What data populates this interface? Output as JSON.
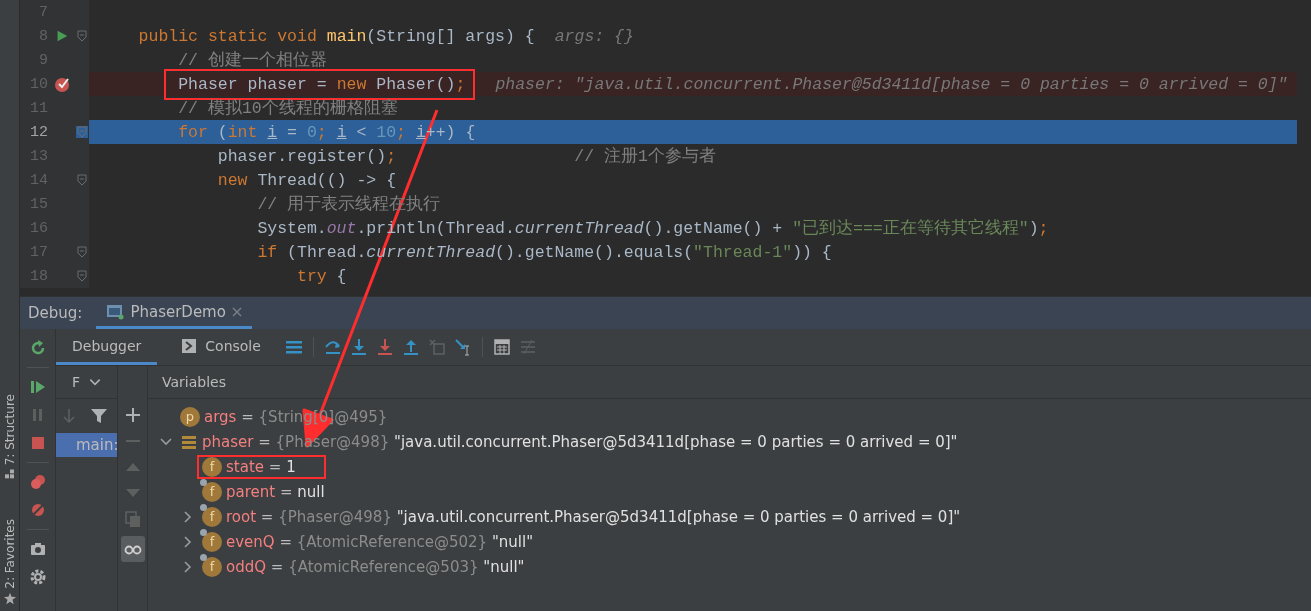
{
  "editor": {
    "lines": [
      {
        "number": "7",
        "kind": "plain",
        "run": false,
        "fold": false,
        "annotated": false
      },
      {
        "number": "8",
        "kind": "plain",
        "run": true,
        "fold": true,
        "annotated": false,
        "tokens": [
          {
            "kind": "keyword",
            "text": "    public static void "
          },
          {
            "kind": "method",
            "text": "main"
          },
          {
            "kind": "plain",
            "text": "(String[] args) {"
          }
        ],
        "hint": "args: {}"
      },
      {
        "number": "9",
        "kind": "plain",
        "run": false,
        "fold": false,
        "annotated": false,
        "tokens": [
          {
            "kind": "comment",
            "text": "        // 创建一个相位器"
          }
        ]
      },
      {
        "number": "10",
        "kind": "breakpoint",
        "run": false,
        "fold": false,
        "annotated": true,
        "tokens": [
          {
            "kind": "plain",
            "text": "        Phaser phaser = "
          },
          {
            "kind": "keyword",
            "text": "new"
          },
          {
            "kind": "plain",
            "text": " Phaser()"
          },
          {
            "kind": "keyword",
            "text": ";"
          }
        ],
        "hint": "phaser: \"java.util.concurrent.Phaser@5d3411d[phase = 0 parties = 0 arrived = 0]\""
      },
      {
        "number": "11",
        "kind": "plain",
        "run": false,
        "fold": false,
        "annotated": false,
        "tokens": [
          {
            "kind": "comment",
            "text": "        // 模拟10个线程的栅格阻塞"
          }
        ]
      },
      {
        "number": "12",
        "kind": "execution",
        "run": false,
        "fold": true,
        "annotated": false,
        "tokens": [
          {
            "kind": "keyword",
            "text": "        for "
          },
          {
            "kind": "plain",
            "text": "("
          },
          {
            "kind": "keyword",
            "text": "int "
          },
          {
            "kind": "variable",
            "text": "i"
          },
          {
            "kind": "plain",
            "text": " = "
          },
          {
            "kind": "number",
            "text": "0"
          },
          {
            "kind": "keyword",
            "text": "; "
          },
          {
            "kind": "variable",
            "text": "i"
          },
          {
            "kind": "plain",
            "text": " < "
          },
          {
            "kind": "number",
            "text": "10"
          },
          {
            "kind": "keyword",
            "text": "; "
          },
          {
            "kind": "variable",
            "text": "i"
          },
          {
            "kind": "plain",
            "text": "++) {"
          }
        ]
      },
      {
        "number": "13",
        "kind": "plain",
        "run": false,
        "fold": false,
        "annotated": false,
        "tokens": [
          {
            "kind": "plain",
            "text": "            phaser.register()"
          },
          {
            "kind": "keyword",
            "text": ";"
          },
          {
            "kind": "comment",
            "text": "                  // 注册1个参与者"
          }
        ]
      },
      {
        "number": "14",
        "kind": "plain",
        "run": false,
        "fold": true,
        "annotated": false,
        "tokens": [
          {
            "kind": "keyword",
            "text": "            new "
          },
          {
            "kind": "plain",
            "text": "Thread(() -> {"
          }
        ]
      },
      {
        "number": "15",
        "kind": "plain",
        "run": false,
        "fold": false,
        "annotated": false,
        "tokens": [
          {
            "kind": "comment",
            "text": "                // 用于表示线程在执行"
          }
        ]
      },
      {
        "number": "16",
        "kind": "plain",
        "run": false,
        "fold": false,
        "annotated": false,
        "tokens": [
          {
            "kind": "plain",
            "text": "                System."
          },
          {
            "kind": "static",
            "text": "out"
          },
          {
            "kind": "plain",
            "text": ".println(Thread."
          },
          {
            "kind": "italic",
            "text": "currentThread"
          },
          {
            "kind": "plain",
            "text": "().getName() + "
          },
          {
            "kind": "string",
            "text": "\"已到达===正在等待其它线程\""
          },
          {
            "kind": "plain",
            "text": ")"
          },
          {
            "kind": "keyword",
            "text": ";"
          }
        ]
      },
      {
        "number": "17",
        "kind": "plain",
        "run": false,
        "fold": true,
        "annotated": false,
        "tokens": [
          {
            "kind": "keyword",
            "text": "                if "
          },
          {
            "kind": "plain",
            "text": "(Thread."
          },
          {
            "kind": "italic",
            "text": "currentThread"
          },
          {
            "kind": "plain",
            "text": "().getName().equals("
          },
          {
            "kind": "string",
            "text": "\"Thread-1\""
          },
          {
            "kind": "plain",
            "text": ")) {"
          }
        ]
      },
      {
        "number": "18",
        "kind": "plain",
        "run": false,
        "fold": true,
        "annotated": false,
        "tokens": [
          {
            "kind": "keyword",
            "text": "                    try "
          },
          {
            "kind": "plain",
            "text": "{"
          }
        ]
      }
    ]
  },
  "side_tabs": [
    "7: Structure",
    "2: Favorites"
  ],
  "debug": {
    "label": "Debug:",
    "session_tab": {
      "label": "PhaserDemo",
      "selected": true
    },
    "tabs": [
      {
        "label": "Debugger",
        "selected": true
      },
      {
        "label": "Console",
        "selected": false
      }
    ],
    "frames": {
      "header": "F",
      "items": [
        {
          "label": "main:",
          "selected": true
        }
      ]
    },
    "variables": {
      "header": "Variables",
      "items": [
        {
          "kind": "param",
          "badge": "p",
          "annotated": false,
          "name": "args",
          "operator": "=",
          "type": "{String[0]@495}"
        },
        {
          "kind": "object",
          "annotated": false,
          "name": "phaser",
          "operator": "=",
          "type": "{Phaser@498}",
          "value": "\"java.util.concurrent.Phaser@5d3411d[phase = 0 parties = 0 arrived = 0]\"",
          "expanded": true,
          "children": [
            {
              "kind": "field",
              "badge": "f",
              "final": false,
              "annotated": true,
              "name": "state",
              "operator": "=",
              "value": "1"
            },
            {
              "kind": "field",
              "badge": "f",
              "final": true,
              "annotated": false,
              "name": "parent",
              "operator": "=",
              "value": "null"
            },
            {
              "kind": "field",
              "badge": "f",
              "final": true,
              "annotated": false,
              "name": "root",
              "operator": "=",
              "type": "{Phaser@498}",
              "value": "\"java.util.concurrent.Phaser@5d3411d[phase = 0 parties = 0 arrived = 0]\"",
              "expanded": false
            },
            {
              "kind": "field",
              "badge": "f",
              "final": true,
              "annotated": false,
              "name": "evenQ",
              "operator": "=",
              "type": "{AtomicReference@502}",
              "value": "\"null\"",
              "expanded": false
            },
            {
              "kind": "field",
              "badge": "f",
              "final": true,
              "annotated": false,
              "name": "oddQ",
              "operator": "=",
              "type": "{AtomicReference@503}",
              "value": "\"null\"",
              "expanded": false
            }
          ]
        }
      ]
    }
  }
}
